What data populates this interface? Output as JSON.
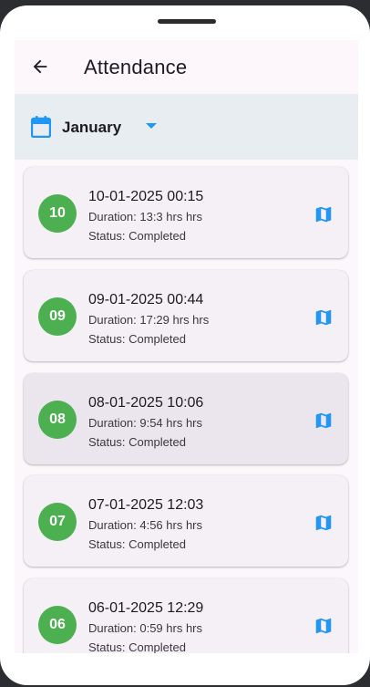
{
  "app": {
    "title": "Attendance"
  },
  "filter": {
    "month": "January"
  },
  "records": [
    {
      "day": "10",
      "datetime": "10-01-2025 00:15",
      "duration": "Duration: 13:3 hrs hrs",
      "status": "Status: Completed"
    },
    {
      "day": "09",
      "datetime": "09-01-2025 00:44",
      "duration": "Duration: 17:29 hrs hrs",
      "status": "Status: Completed"
    },
    {
      "day": "08",
      "datetime": "08-01-2025 10:06",
      "duration": "Duration: 9:54 hrs hrs",
      "status": "Status: Completed"
    },
    {
      "day": "07",
      "datetime": "07-01-2025 12:03",
      "duration": "Duration: 4:56 hrs hrs",
      "status": "Status: Completed"
    },
    {
      "day": "06",
      "datetime": "06-01-2025 12:29",
      "duration": "Duration: 0:59 hrs hrs",
      "status": "Status: Completed"
    }
  ],
  "colors": {
    "accent": "#2196f3",
    "avatar": "#4caf50"
  },
  "icons": {
    "back": "arrow-back-icon",
    "calendar": "calendar-icon",
    "dropdown": "caret-down-icon",
    "map": "map-icon"
  }
}
